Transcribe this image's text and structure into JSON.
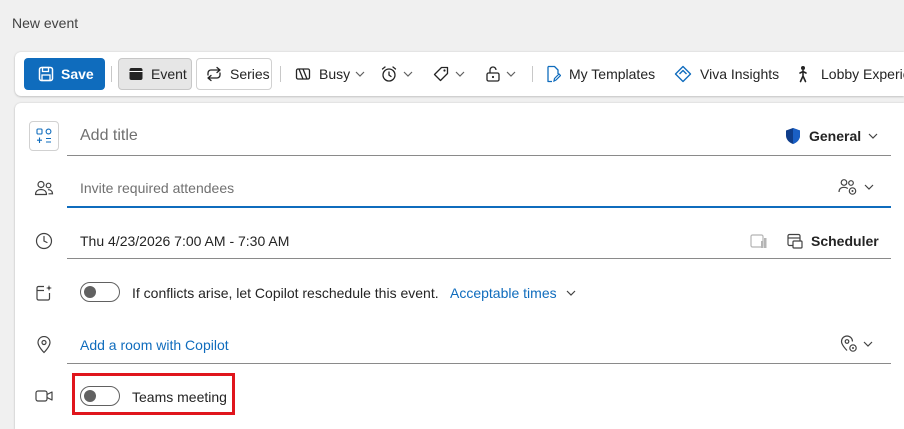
{
  "window": {
    "title": "New event"
  },
  "toolbar": {
    "save_label": "Save",
    "event_label": "Event",
    "series_label": "Series",
    "busy_label": "Busy",
    "templates_label": "My Templates",
    "viva_label": "Viva Insights",
    "lobby_label": "Lobby Experie"
  },
  "form": {
    "title_placeholder": "Add title",
    "category_label": "General",
    "attendees_placeholder": "Invite required attendees",
    "datetime": "Thu 4/23/2026 7:00 AM - 7:30 AM",
    "scheduler_label": "Scheduler",
    "copilot_text": "If conflicts arise, let Copilot reschedule this event.",
    "acceptable_times_label": "Acceptable times",
    "room_link": "Add a room with Copilot",
    "teams_label": "Teams meeting",
    "copilot_toggle_on": false,
    "teams_toggle_on": false
  },
  "colors": {
    "accent": "#0f6cbd",
    "highlight": "#e0151c"
  }
}
